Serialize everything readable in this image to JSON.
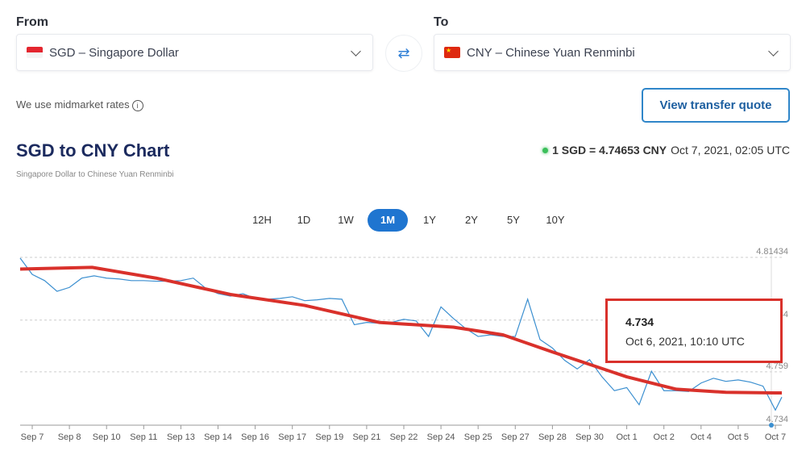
{
  "from": {
    "label": "From",
    "value": "SGD – Singapore Dollar",
    "flag": "singapore-flag"
  },
  "to": {
    "label": "To",
    "value": "CNY – Chinese Yuan Renminbi",
    "flag": "china-flag"
  },
  "swap_icon": "swap-arrows-icon",
  "midmarket": "We use midmarket rates",
  "quote_button": "View transfer quote",
  "title": "SGD to CNY Chart",
  "subtitle": "Singapore Dollar to Chinese Yuan Renminbi",
  "rate": {
    "pair": "1 SGD = 4.74653 CNY",
    "time": "Oct 7, 2021, 02:05 UTC",
    "status_color": "#3bbf5a"
  },
  "tabs": [
    {
      "label": "12H"
    },
    {
      "label": "1D"
    },
    {
      "label": "1W"
    },
    {
      "label": "1M",
      "active": true
    },
    {
      "label": "1Y"
    },
    {
      "label": "2Y"
    },
    {
      "label": "5Y"
    },
    {
      "label": "10Y"
    }
  ],
  "tooltip": {
    "value": "4.734",
    "time": "Oct 6, 2021, 10:10 UTC"
  },
  "colors": {
    "accent": "#1f75d0",
    "line": "#3b8fd0",
    "annotation": "#d9312b"
  },
  "chart_data": {
    "type": "line",
    "x_ticks": [
      "Sep 7",
      "Sep 8",
      "Sep 10",
      "Sep 11",
      "Sep 13",
      "Sep 14",
      "Sep 16",
      "Sep 17",
      "Sep 19",
      "Sep 21",
      "Sep 22",
      "Sep 24",
      "Sep 25",
      "Sep 27",
      "Sep 28",
      "Sep 30",
      "Oct 1",
      "Oct 2",
      "Oct 4",
      "Oct 5",
      "Oct 7"
    ],
    "y_ticks": [
      "4.81434",
      "4.784",
      "4.759",
      "4.734"
    ],
    "ylim": [
      4.734,
      4.8155
    ],
    "xlim": [
      "2021-09-07T00:00",
      "2021-10-07T00:00"
    ],
    "grid": "horizontal dashed",
    "series": [
      {
        "x_start": "2021-09-07T00:00",
        "x_step_hours": 12,
        "values": [
          4.8061,
          4.8031,
          4.7979,
          4.7998,
          4.8043,
          4.8054,
          4.8043,
          4.8039,
          4.8031,
          4.8031,
          4.8028,
          4.8028,
          4.8031,
          4.8043,
          4.7994,
          4.7968,
          4.7956,
          4.7968,
          4.7945,
          4.7941,
          4.7945,
          4.7953,
          4.7934,
          4.7938,
          4.7945,
          4.7941,
          4.7818,
          4.7829,
          4.7825,
          4.7829,
          4.7844,
          4.7836,
          4.7761,
          4.7904,
          4.7848,
          4.7799,
          4.7761,
          4.7769,
          4.7761,
          4.7761,
          4.7941,
          4.7746,
          4.7705,
          4.7645,
          4.7604,
          4.7649,
          4.7566,
          4.7499,
          4.7514,
          4.7431,
          4.7593,
          4.7499,
          4.7499,
          4.7495,
          4.7536,
          4.7559,
          4.7544,
          4.7551,
          4.754,
          4.7521,
          4.7405
        ]
      },
      {
        "annotation": "trend",
        "points": [
          [
            "2021-09-07T00:00",
            4.8087
          ],
          [
            "2021-09-09T10:00",
            4.8095
          ],
          [
            "2021-09-12T00:00",
            4.8043
          ],
          [
            "2021-09-15T00:00",
            4.7964
          ],
          [
            "2021-09-18T00:00",
            4.7911
          ],
          [
            "2021-09-21T00:00",
            4.7829
          ],
          [
            "2021-09-24T00:00",
            4.7806
          ],
          [
            "2021-09-26T00:00",
            4.7769
          ],
          [
            "2021-09-28T00:00",
            4.7686
          ],
          [
            "2021-10-01T00:00",
            4.7566
          ],
          [
            "2021-10-03T00:00",
            4.7506
          ],
          [
            "2021-10-05T00:00",
            4.7491
          ],
          [
            "2021-10-07T00:00",
            4.7488
          ]
        ]
      }
    ]
  }
}
